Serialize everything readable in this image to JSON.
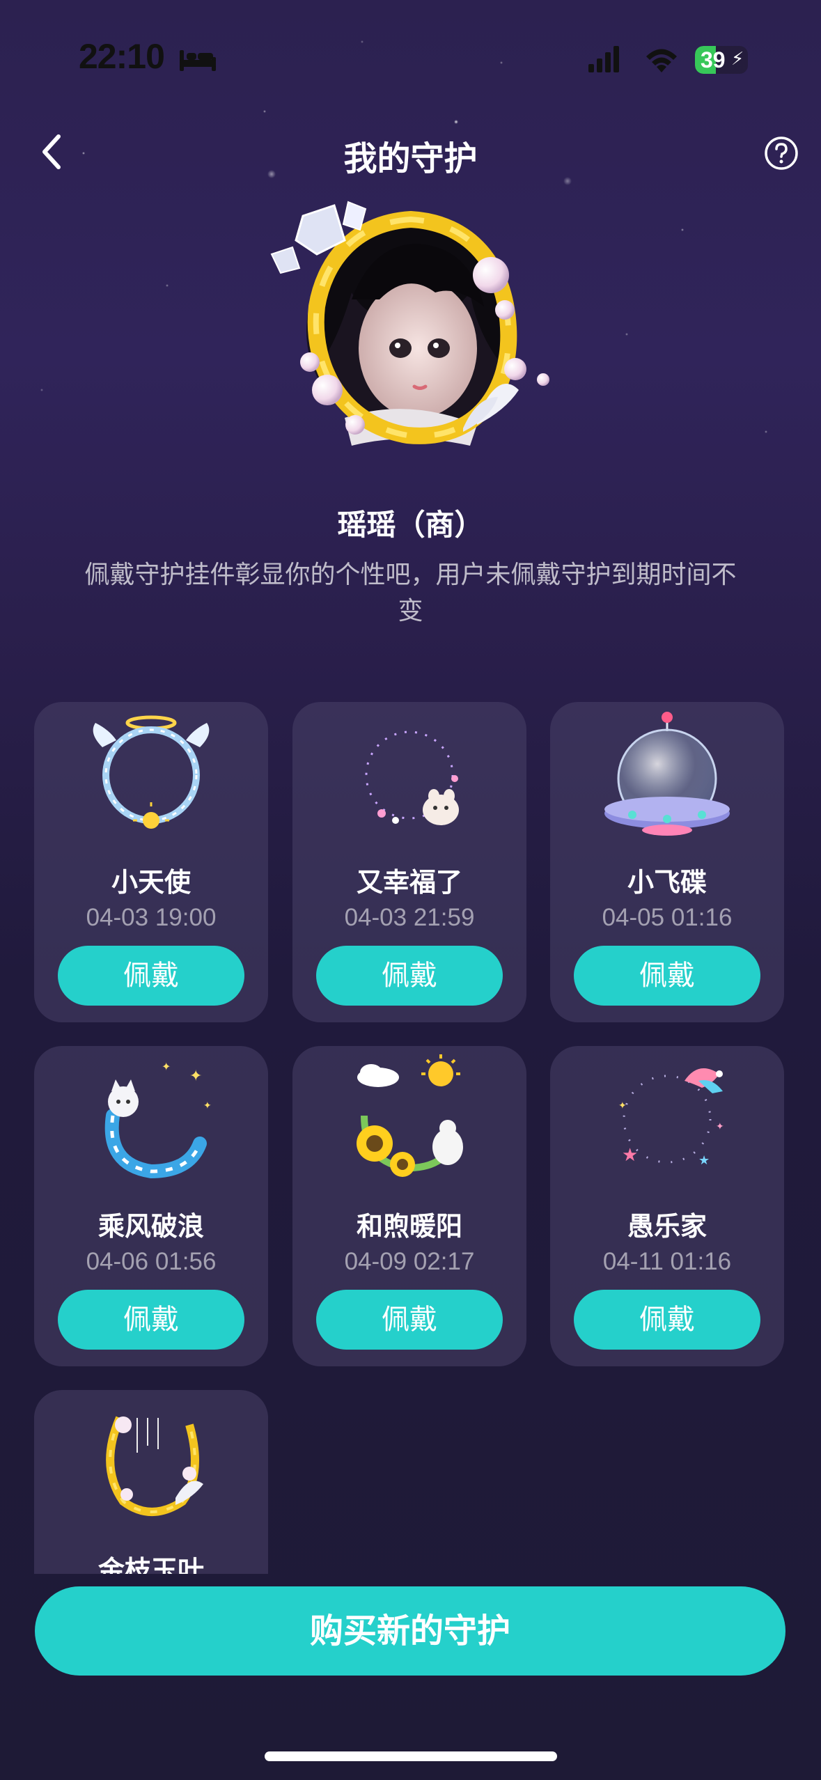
{
  "status_bar": {
    "time": "22:10",
    "battery": "39",
    "battery_level_percent": 39,
    "icons": [
      "bed-icon",
      "signal-icon",
      "wifi-icon",
      "battery-icon"
    ]
  },
  "header": {
    "title": "我的守护",
    "back_icon": "chevron-left-icon",
    "help_icon": "question-circle-icon"
  },
  "profile": {
    "name": "瑶瑶（商）",
    "description": "佩戴守护挂件彰显你的个性吧，用户未佩戴守护到期时间不变",
    "avatar_icon": "avatar-with-gold-frame"
  },
  "guards": [
    {
      "name": "小天使",
      "date": "04-03 19:00",
      "button": "佩戴",
      "icon": "angel-wings-frame-icon"
    },
    {
      "name": "又幸福了",
      "date": "04-03 21:59",
      "button": "佩戴",
      "icon": "happiness-frame-icon"
    },
    {
      "name": "小飞碟",
      "date": "04-05 01:16",
      "button": "佩戴",
      "icon": "ufo-frame-icon"
    },
    {
      "name": "乘风破浪",
      "date": "04-06 01:56",
      "button": "佩戴",
      "icon": "wave-cat-frame-icon"
    },
    {
      "name": "和煦暖阳",
      "date": "04-09 02:17",
      "button": "佩戴",
      "icon": "sunflower-frame-icon"
    },
    {
      "name": "愚乐家",
      "date": "04-11 01:16",
      "button": "佩戴",
      "icon": "jester-frame-icon"
    },
    {
      "name": "金枝玉叶",
      "date": "",
      "button": "",
      "icon": "golden-branch-frame-icon"
    }
  ],
  "footer": {
    "buy_label": "购买新的守护"
  },
  "colors": {
    "accent": "#25d0cb",
    "background_top": "#2c2150",
    "background_bottom": "#1e1a36",
    "card": "#484268"
  }
}
